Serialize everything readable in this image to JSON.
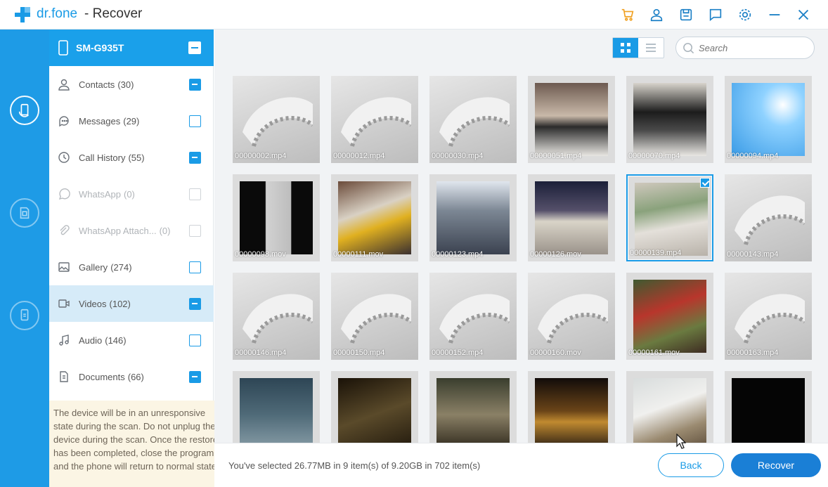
{
  "app": {
    "brand": "dr.fone",
    "separator": "- Recover",
    "brand_color": "#1a9be6"
  },
  "titlebar_icons": [
    "cart-icon",
    "user-icon",
    "save-icon",
    "feedback-icon",
    "settings-icon",
    "minimize-icon",
    "close-icon"
  ],
  "rail": {
    "items": [
      "phone-recover-icon",
      "sim-recover-icon",
      "backup-recover-icon"
    ]
  },
  "device": {
    "name": "SM-G935T",
    "state": "partial"
  },
  "categories": [
    {
      "label": "Contacts",
      "count": "(30)",
      "icon": "contact-icon",
      "state": "partial",
      "enabled": true,
      "selected": false
    },
    {
      "label": "Messages",
      "count": "(29)",
      "icon": "message-icon",
      "state": "none",
      "enabled": true,
      "selected": false
    },
    {
      "label": "Call History",
      "count": "(55)",
      "icon": "clock-icon",
      "state": "partial",
      "enabled": true,
      "selected": false
    },
    {
      "label": "WhatsApp",
      "count": "(0)",
      "icon": "whatsapp-icon",
      "state": "none",
      "enabled": false,
      "selected": false
    },
    {
      "label": "WhatsApp Attach...",
      "count": "(0)",
      "icon": "paperclip-icon",
      "state": "none",
      "enabled": false,
      "selected": false
    },
    {
      "label": "Gallery",
      "count": "(274)",
      "icon": "image-icon",
      "state": "none",
      "enabled": true,
      "selected": false
    },
    {
      "label": "Videos",
      "count": "(102)",
      "icon": "video-icon",
      "state": "partial",
      "enabled": true,
      "selected": true
    },
    {
      "label": "Audio",
      "count": "(146)",
      "icon": "music-icon",
      "state": "none",
      "enabled": true,
      "selected": false
    },
    {
      "label": "Documents",
      "count": "(66)",
      "icon": "document-icon",
      "state": "partial",
      "enabled": true,
      "selected": false
    }
  ],
  "notice": "The device will be in an unresponsive state during the scan. Do not unplug the device during the scan. Once the restore has been completed, close the program and the phone will return to normal state.",
  "view": {
    "mode": "grid"
  },
  "search": {
    "placeholder": "Search",
    "value": ""
  },
  "files": [
    {
      "name": "00000002.mp4",
      "thumb": "reel",
      "selected": false
    },
    {
      "name": "00000012.mp4",
      "thumb": "reel",
      "selected": false
    },
    {
      "name": "00000030.mp4",
      "thumb": "reel",
      "selected": false
    },
    {
      "name": "00000051.mp4",
      "thumb": "desk-keyboard",
      "selected": false
    },
    {
      "name": "00000070.mp4",
      "thumb": "desk-laptop",
      "selected": false
    },
    {
      "name": "00000094.mp4",
      "thumb": "blue-sky",
      "selected": false
    },
    {
      "name": "00000098.mov",
      "thumb": "dark-desk",
      "selected": false
    },
    {
      "name": "00000111.mov",
      "thumb": "cluttered-desk",
      "selected": false
    },
    {
      "name": "00000123.mp4",
      "thumb": "city-buildings",
      "selected": false
    },
    {
      "name": "00000126.mov",
      "thumb": "night-street",
      "selected": false
    },
    {
      "name": "00000139.mp4",
      "thumb": "table-plant",
      "selected": true
    },
    {
      "name": "00000143.mp4",
      "thumb": "reel",
      "selected": false
    },
    {
      "name": "00000146.mp4",
      "thumb": "reel",
      "selected": false
    },
    {
      "name": "00000150.mp4",
      "thumb": "reel",
      "selected": false
    },
    {
      "name": "00000152.mp4",
      "thumb": "reel",
      "selected": false
    },
    {
      "name": "00000160.mov",
      "thumb": "reel",
      "selected": false
    },
    {
      "name": "00000161.mov",
      "thumb": "market-stall",
      "selected": false
    },
    {
      "name": "00000163.mp4",
      "thumb": "reel",
      "selected": false
    },
    {
      "name": "",
      "thumb": "snowy-car",
      "selected": false
    },
    {
      "name": "",
      "thumb": "dark-room",
      "selected": false
    },
    {
      "name": "",
      "thumb": "crowd",
      "selected": false
    },
    {
      "name": "",
      "thumb": "night-lights",
      "selected": false
    },
    {
      "name": "",
      "thumb": "stairs-person",
      "selected": false
    },
    {
      "name": "",
      "thumb": "black-screen",
      "selected": false
    }
  ],
  "footer": {
    "selection": "You've selected 26.77MB in 9 item(s) of 9.20GB in 702 item(s)",
    "back_label": "Back",
    "recover_label": "Recover"
  }
}
